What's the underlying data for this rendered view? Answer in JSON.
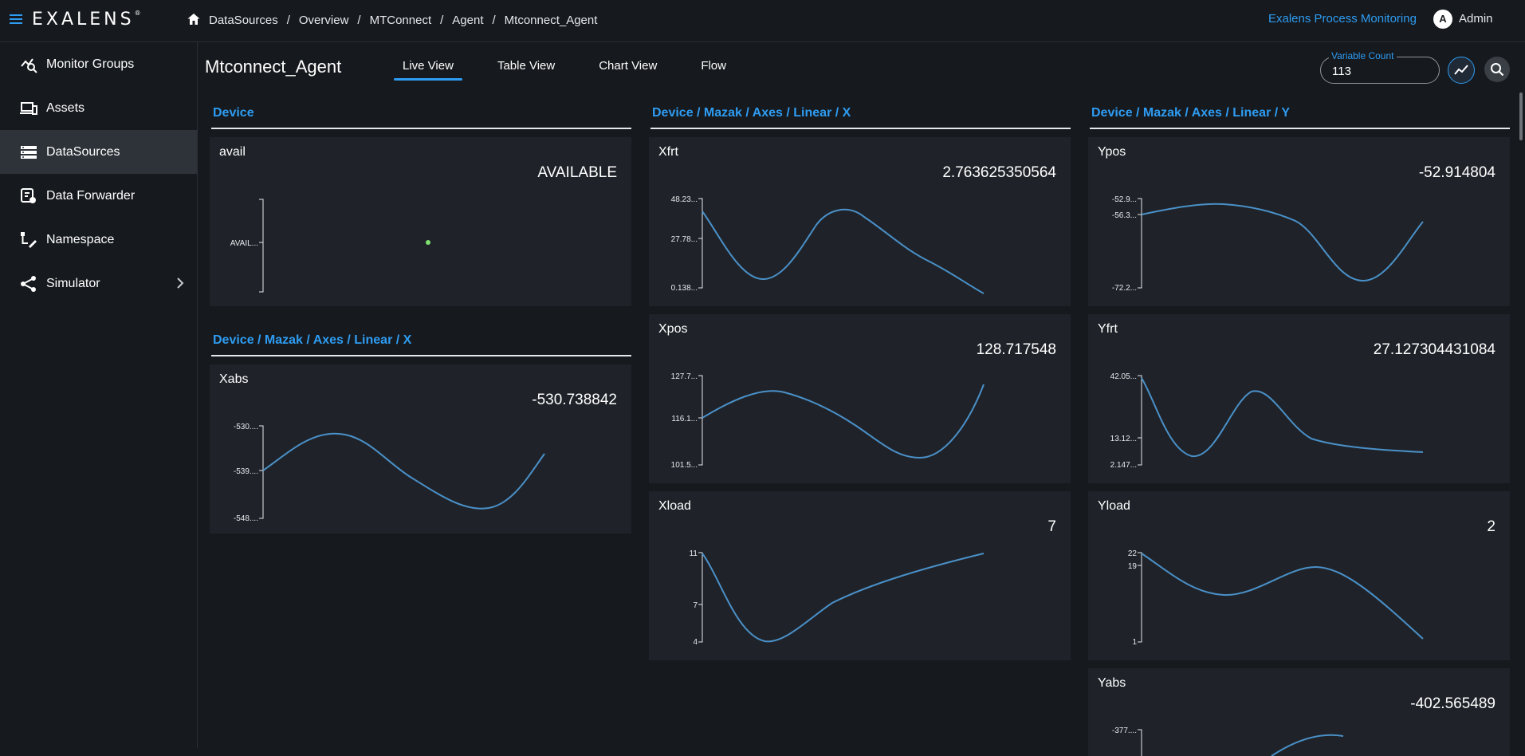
{
  "header": {
    "logo": "EXALENS",
    "breadcrumb": [
      "DataSources",
      "Overview",
      "MTConnect",
      "Agent",
      "Mtconnect_Agent"
    ],
    "app_link": "Exalens Process Monitoring",
    "user_initial": "A",
    "user_name": "Admin"
  },
  "sidebar": {
    "items": [
      {
        "label": "Monitor Groups",
        "icon": "monitor-groups-icon"
      },
      {
        "label": "Assets",
        "icon": "assets-icon"
      },
      {
        "label": "DataSources",
        "icon": "datasources-icon",
        "active": true
      },
      {
        "label": "Data Forwarder",
        "icon": "data-forwarder-icon"
      },
      {
        "label": "Namespace",
        "icon": "namespace-icon"
      },
      {
        "label": "Simulator",
        "icon": "simulator-icon",
        "has_submenu": true
      }
    ]
  },
  "page": {
    "title": "Mtconnect_Agent",
    "tabs": [
      "Live View",
      "Table View",
      "Chart View",
      "Flow"
    ],
    "active_tab": "Live View",
    "variable_count_label": "Variable Count",
    "variable_count_value": "113"
  },
  "colors": {
    "accent": "#2e9cf2",
    "line": "#4a90c8",
    "point": "#7ee06e"
  },
  "groups": [
    {
      "title": "Device",
      "cards": [
        {
          "name": "avail",
          "value": "AVAILABLE",
          "ticks": [
            "AVAIL..."
          ]
        }
      ]
    },
    {
      "title": "Device / Mazak / Axes / Linear / X",
      "cards": [
        {
          "name": "Xabs",
          "value": "-530.738842",
          "ticks": [
            "-530....",
            "-539....",
            "-548...."
          ]
        }
      ]
    },
    {
      "title": "Device / Mazak / Axes / Linear / X",
      "cards": [
        {
          "name": "Xfrt",
          "value": "2.763625350564",
          "ticks": [
            "48.23...",
            "27.78...",
            "0.138..."
          ]
        },
        {
          "name": "Xpos",
          "value": "128.717548",
          "ticks": [
            "127.7...",
            "116.1...",
            "101.5..."
          ]
        },
        {
          "name": "Xload",
          "value": "7",
          "ticks": [
            "11",
            "7",
            "4"
          ]
        }
      ]
    },
    {
      "title": "Device / Mazak / Axes / Linear / Y",
      "cards": [
        {
          "name": "Ypos",
          "value": "-52.914804",
          "ticks": [
            "-52.9...",
            "-56.3...",
            "-72.2..."
          ]
        },
        {
          "name": "Yfrt",
          "value": "27.127304431084",
          "ticks": [
            "42.05...",
            "13.12...",
            "2.147..."
          ]
        },
        {
          "name": "Yload",
          "value": "2",
          "ticks": [
            "22",
            "19",
            "1"
          ]
        },
        {
          "name": "Yabs",
          "value": "-402.565489",
          "ticks": [
            "-377...."
          ]
        }
      ]
    }
  ]
}
